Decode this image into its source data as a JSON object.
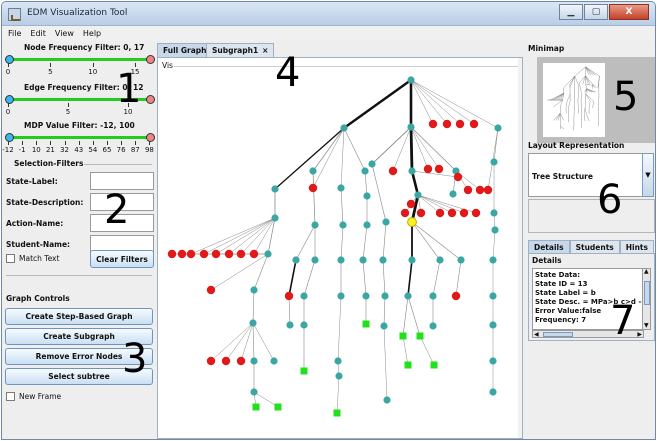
{
  "window": {
    "title": "EDM Visualization Tool",
    "controls": {
      "minimize": "▁",
      "maximize": "▢",
      "close": "X"
    }
  },
  "menu": [
    "File",
    "Edit",
    "View",
    "Help"
  ],
  "filters": {
    "node_frequency": {
      "label": "Node Frequency Filter: 0, 17",
      "ticks": [
        "0",
        "5",
        "10",
        "15"
      ],
      "range": [
        0,
        17
      ]
    },
    "edge_frequency": {
      "label": "Edge Frequency Filter: 0, 12",
      "ticks": [
        "0",
        "5",
        "10"
      ],
      "range": [
        0,
        12
      ]
    },
    "mdp_value": {
      "label": "MDP Value Filter: -12, 100",
      "ticks": [
        "-12",
        "-1",
        "10",
        "21",
        "32",
        "43",
        "54",
        "65",
        "76",
        "87",
        "98"
      ],
      "range": [
        -12,
        100
      ]
    }
  },
  "selection_filters": {
    "title": "Selection-Filters",
    "fields": [
      {
        "label": "State-Label:",
        "value": ""
      },
      {
        "label": "State-Description:",
        "value": ""
      },
      {
        "label": "Action-Name:",
        "value": ""
      },
      {
        "label": "Student-Name:",
        "value": ""
      }
    ],
    "match_text": "Match Text",
    "clear_filters": "Clear Filters"
  },
  "graph_controls": {
    "title": "Graph Controls",
    "buttons": [
      "Create Step-Based Graph",
      "Create Subgraph",
      "Remove Error Nodes",
      "Select subtree"
    ],
    "new_frame": "New Frame"
  },
  "center": {
    "tabs": [
      {
        "label": "Full Graph",
        "active": true
      },
      {
        "label": "Subgraph1",
        "close": "×",
        "active": false
      }
    ],
    "vis_label": "Vis"
  },
  "right": {
    "minimap_title": "Minimap",
    "layout_title": "Layout Representation",
    "layout_value": "Tree Structure",
    "layout_arrow": "▼",
    "tabs": [
      {
        "label": "Details",
        "active": true
      },
      {
        "label": "Students",
        "active": false
      },
      {
        "label": "Hints",
        "active": false
      }
    ],
    "details_title": "Details",
    "details_lines": [
      "State Data:",
      "State ID = 13",
      "State Label = b",
      "State Desc. = MPa>b c>d -(a>c",
      "Error Value:false",
      "Frequency: 7"
    ]
  },
  "overlay_numbers": [
    "1",
    "2",
    "3",
    "4",
    "5",
    "6",
    "7"
  ],
  "colors": {
    "node_teal": "#3aa7a3",
    "node_error": "#e01a1a",
    "node_goal": "#22e01a",
    "node_selected": "#f7f223",
    "slider_track": "#22cc22",
    "knob_left": "#39b7ef",
    "knob_right": "#f08585"
  },
  "graph": {
    "root": "n0",
    "nodes": [
      {
        "id": "n0",
        "type": "normal"
      },
      {
        "id": "a1",
        "type": "normal"
      },
      {
        "id": "a2",
        "type": "normal"
      },
      {
        "id": "a3",
        "type": "normal"
      },
      {
        "id": "a4",
        "type": "normal"
      },
      {
        "id": "a5",
        "type": "normal"
      },
      {
        "id": "a6",
        "type": "normal"
      },
      {
        "id": "a7",
        "type": "error"
      },
      {
        "id": "a8",
        "type": "error"
      },
      {
        "id": "a9",
        "type": "error"
      },
      {
        "id": "a10",
        "type": "error"
      },
      {
        "id": "a11",
        "type": "normal"
      },
      {
        "id": "b1",
        "type": "normal"
      },
      {
        "id": "b2",
        "type": "normal"
      },
      {
        "id": "b3",
        "type": "error"
      },
      {
        "id": "b4",
        "type": "normal"
      },
      {
        "id": "b5",
        "type": "normal"
      },
      {
        "id": "b6",
        "type": "error"
      },
      {
        "id": "b7",
        "type": "normal"
      },
      {
        "id": "b8",
        "type": "normal"
      },
      {
        "id": "b9",
        "type": "error"
      },
      {
        "id": "b10",
        "type": "error"
      },
      {
        "id": "b11",
        "type": "normal"
      },
      {
        "id": "b12",
        "type": "error"
      },
      {
        "id": "b13",
        "type": "error"
      },
      {
        "id": "b14",
        "type": "error"
      },
      {
        "id": "b15",
        "type": "error"
      },
      {
        "id": "b16",
        "type": "normal"
      },
      {
        "id": "c1",
        "type": "normal"
      },
      {
        "id": "c2",
        "type": "normal"
      },
      {
        "id": "c3",
        "type": "normal"
      },
      {
        "id": "c4",
        "type": "normal"
      },
      {
        "id": "c5",
        "type": "normal"
      },
      {
        "id": "c6",
        "type": "selected"
      },
      {
        "id": "c7",
        "type": "error"
      },
      {
        "id": "c8",
        "type": "error"
      },
      {
        "id": "c9",
        "type": "error"
      },
      {
        "id": "c10",
        "type": "error"
      },
      {
        "id": "c11",
        "type": "error"
      },
      {
        "id": "c12",
        "type": "error"
      },
      {
        "id": "c13",
        "type": "normal"
      },
      {
        "id": "c14",
        "type": "error"
      },
      {
        "id": "d1",
        "type": "error"
      },
      {
        "id": "d2",
        "type": "error"
      },
      {
        "id": "d3",
        "type": "error"
      },
      {
        "id": "d4",
        "type": "error"
      },
      {
        "id": "d5",
        "type": "error"
      },
      {
        "id": "d6",
        "type": "error"
      },
      {
        "id": "d7",
        "type": "normal"
      },
      {
        "id": "d8",
        "type": "normal"
      },
      {
        "id": "d9",
        "type": "normal"
      },
      {
        "id": "d10",
        "type": "normal"
      },
      {
        "id": "d11",
        "type": "normal"
      },
      {
        "id": "d12",
        "type": "normal"
      },
      {
        "id": "d13",
        "type": "normal"
      },
      {
        "id": "d14",
        "type": "normal"
      },
      {
        "id": "d15",
        "type": "normal"
      },
      {
        "id": "d16",
        "type": "normal"
      },
      {
        "id": "e1",
        "type": "error"
      },
      {
        "id": "e2",
        "type": "error"
      },
      {
        "id": "e3",
        "type": "error"
      },
      {
        "id": "e4",
        "type": "normal"
      },
      {
        "id": "e5",
        "type": "error"
      },
      {
        "id": "e6",
        "type": "normal"
      },
      {
        "id": "e7",
        "type": "normal"
      },
      {
        "id": "e8",
        "type": "normal"
      },
      {
        "id": "e9",
        "type": "normal"
      },
      {
        "id": "e10",
        "type": "normal"
      },
      {
        "id": "e11",
        "type": "normal"
      },
      {
        "id": "e12",
        "type": "error"
      },
      {
        "id": "e13",
        "type": "normal"
      },
      {
        "id": "f1",
        "type": "normal"
      },
      {
        "id": "f2",
        "type": "normal"
      },
      {
        "id": "f3",
        "type": "normal"
      },
      {
        "id": "f4",
        "type": "goal"
      },
      {
        "id": "f5",
        "type": "normal"
      },
      {
        "id": "f6",
        "type": "goal"
      },
      {
        "id": "f7",
        "type": "goal"
      },
      {
        "id": "f8",
        "type": "normal"
      },
      {
        "id": "f9",
        "type": "normal"
      },
      {
        "id": "g1",
        "type": "error"
      },
      {
        "id": "g2",
        "type": "error"
      },
      {
        "id": "g3",
        "type": "error"
      },
      {
        "id": "g4",
        "type": "normal"
      },
      {
        "id": "g5",
        "type": "normal"
      },
      {
        "id": "g6",
        "type": "goal"
      },
      {
        "id": "g7",
        "type": "normal"
      },
      {
        "id": "g8",
        "type": "goal"
      },
      {
        "id": "g9",
        "type": "goal"
      },
      {
        "id": "g10",
        "type": "normal"
      },
      {
        "id": "h1",
        "type": "normal"
      },
      {
        "id": "h2",
        "type": "normal"
      },
      {
        "id": "h3",
        "type": "normal"
      },
      {
        "id": "h4",
        "type": "normal"
      },
      {
        "id": "i1",
        "type": "goal"
      },
      {
        "id": "i2",
        "type": "goal"
      },
      {
        "id": "i3",
        "type": "goal"
      }
    ]
  }
}
